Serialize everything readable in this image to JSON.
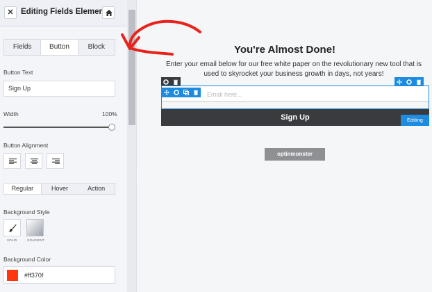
{
  "sidebar": {
    "title": "Editing Fields Element",
    "close_icon": "close-icon",
    "home_icon": "home-icon",
    "tabs": [
      {
        "label": "Fields"
      },
      {
        "label": "Button"
      },
      {
        "label": "Block"
      }
    ],
    "active_tab": "Button",
    "button_text_label": "Button Text",
    "button_text_value": "Sign Up",
    "width_label": "Width",
    "width_value": "100%",
    "width_fraction": 1.0,
    "alignment_label": "Button Alignment",
    "alignment_options": [
      "align-left-icon",
      "align-center-icon",
      "align-right-icon"
    ],
    "state_tabs": [
      {
        "label": "Regular"
      },
      {
        "label": "Hover"
      },
      {
        "label": "Action"
      }
    ],
    "active_state": "Regular",
    "bg_style_label": "Background Style",
    "bg_styles": [
      {
        "caption": "SOLID",
        "icon": "brush-icon"
      },
      {
        "caption": "GRADIENT",
        "icon": "gradient-icon"
      }
    ],
    "bg_color_label": "Background Color",
    "bg_color_value": "#ff370f",
    "bg_color_hex": "#ff370f"
  },
  "canvas": {
    "headline": "You're Almost Done!",
    "description": "Enter your email below for our free white paper on the revolutionary new tool that is used to skyrocket your business growth in days, not years!",
    "email_placeholder": "Email here...",
    "button_label": "Sign Up",
    "editing_badge": "Editing",
    "brand": "optinmonster"
  },
  "colors": {
    "accent_blue": "#1d8be0",
    "button_dark": "#3a3b3e",
    "annotation_red": "#e8231c"
  }
}
